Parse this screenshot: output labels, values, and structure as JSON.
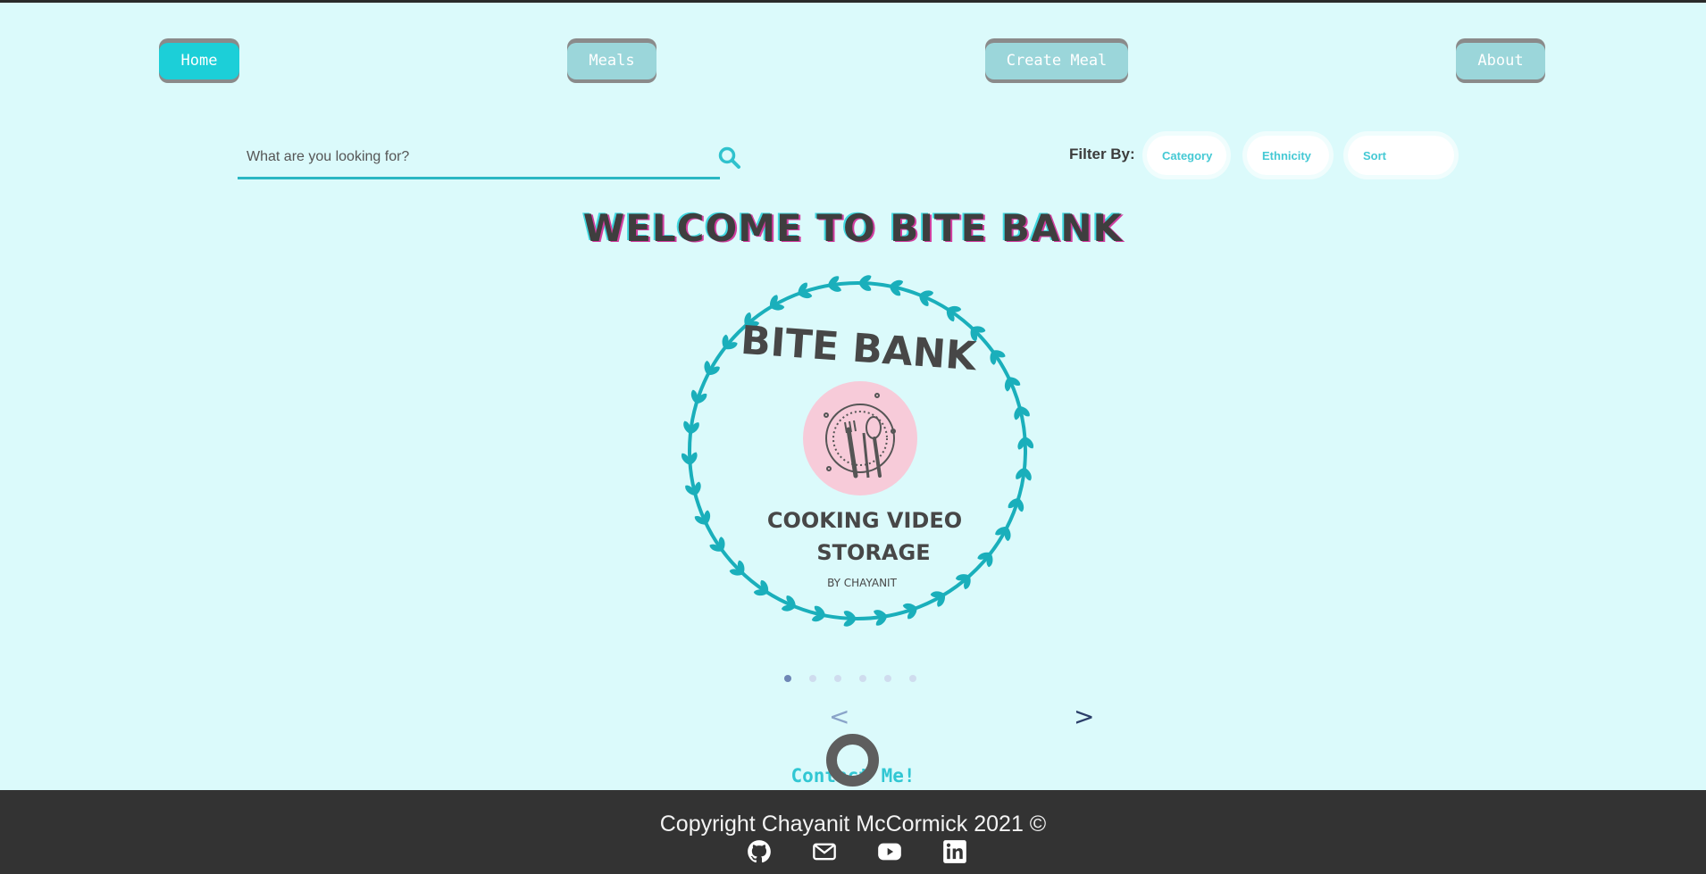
{
  "nav": {
    "home": "Home",
    "meals": "Meals",
    "create_meal": "Create Meal",
    "about": "About",
    "active": "Home"
  },
  "search": {
    "placeholder": "What are you looking for?",
    "value": "",
    "icon": "search-icon"
  },
  "filter": {
    "label": "Filter By:",
    "category": "Category",
    "ethnicity": "Ethnicity",
    "sort": "Sort"
  },
  "hero": {
    "title": "WELCOME TO BITE BANK"
  },
  "logo": {
    "brand": "BITE BANK",
    "line1": "COOKING VIDEO",
    "line2": "STORAGE",
    "byline": "BY CHAYANIT"
  },
  "carousel": {
    "slide_count": 6,
    "active_index": 0,
    "prev": "<",
    "next": ">"
  },
  "contact": {
    "label": "Contact Me!"
  },
  "footer": {
    "copyright": "Copyright Chayanit McCormick 2021 ©",
    "social": [
      "github-icon",
      "mail-icon",
      "youtube-icon",
      "linkedin-icon"
    ]
  },
  "colors": {
    "background": "#dbfafb",
    "accent": "#1ccfd8",
    "nav_inactive": "#9bd6da",
    "footer": "#333333",
    "wreath": "#1aafbb",
    "plate_circle": "#f7cbd9"
  }
}
